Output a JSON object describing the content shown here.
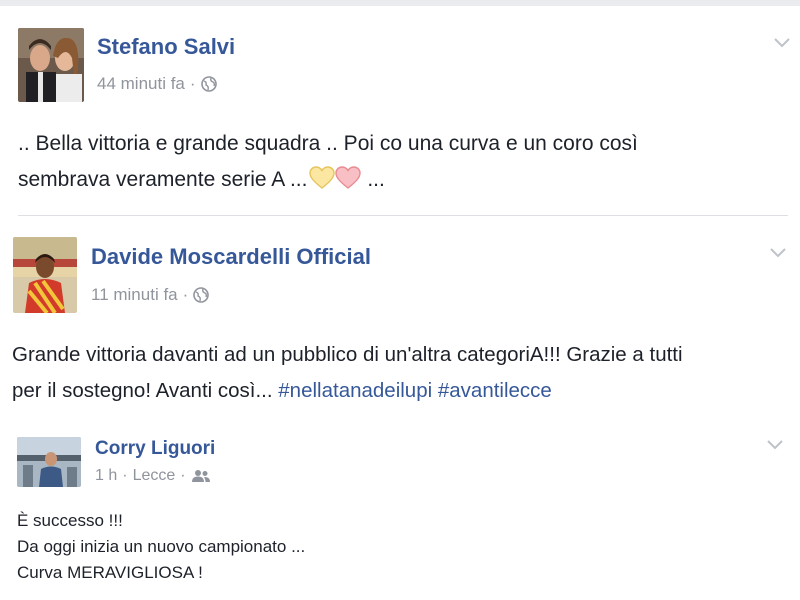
{
  "posts": [
    {
      "author": "Stefano Salvi",
      "time": "44 minuti fa",
      "audience_icon": "globe-icon",
      "lines": [
        ".. Bella vittoria e grande squadra .. Poi co una curva e un coro così",
        "sembrava veramente serie A ..."
      ],
      "line_suffix": "...",
      "emoji": [
        "yellow-heart",
        "red-heart"
      ]
    },
    {
      "author": "Davide Moscardelli Official",
      "time": "11 minuti fa",
      "audience_icon": "globe-icon",
      "line1": "Grande vittoria davanti ad un pubblico di un'altra categoriA!!! Grazie a tutti",
      "line2_text": "per il sostegno! Avanti così...",
      "hashtags": [
        "#nellatanadeilupi",
        "#avantilecce"
      ]
    },
    {
      "author": "Corry Liguori",
      "time": "1 h",
      "location": "Lecce",
      "audience_icon": "friends-icon",
      "lines": [
        "È successo !!!",
        "Da oggi inizia un nuovo campionato ...",
        "Curva MERAVIGLIOSA !"
      ]
    }
  ],
  "colors": {
    "author": "#365899",
    "meta": "#90949c",
    "text": "#1d2129",
    "divider": "#dddfe2",
    "hashtag": "#365899"
  }
}
